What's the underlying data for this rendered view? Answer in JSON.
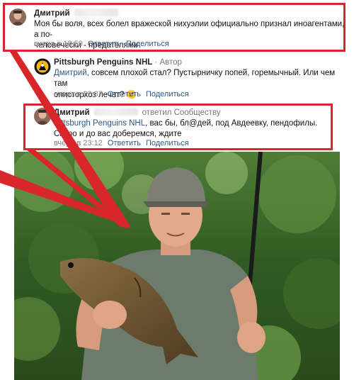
{
  "comments": [
    {
      "author": "Дмитрий",
      "text": "Моя бы воля, всех болел вражеской нихуэлии официально признал иноагентами, а по-человечески - предателями",
      "text_line1": "Моя бы воля, всех болел вражеской нихуэлии официально признал иноагентами, а по-",
      "text_line2": "человечески - предателями",
      "time": "вчера в 18:59",
      "reply_label": "Ответить",
      "share_label": "Поделиться"
    },
    {
      "author": "Pittsburgh Penguins NHL",
      "author_tag": " · Автор",
      "mention": "Дмитрий",
      "text_line1": ", совсем плохой стал? Пустырничку попей, горемычный. Или чем там",
      "text_line2": "описторхоз лечат? ",
      "emoji": "🙂",
      "time": "вчера в 22:37",
      "reply_label": "Ответить",
      "share_label": "Поделиться"
    },
    {
      "author": "Дмитрий",
      "author_tag": "ответил Сообществу",
      "mention": "Pittsburgh Penguins NHL",
      "text_line1": ", вас бы, бл@дей, под Авдеевку, пендофилы.",
      "text_line2": "Скоро и до вас доберемся, ждите",
      "time": "вчера в 23:12",
      "reply_label": "Ответить",
      "share_label": "Поделиться"
    }
  ],
  "colors": {
    "highlight_frame": "#d8262b",
    "link": "#2a5885",
    "meta": "#828282"
  },
  "icons": {
    "avatar_dmitry": "avatar-man-photo",
    "avatar_penguins": "penguins-logo",
    "photo": "fisherman-with-carp"
  }
}
